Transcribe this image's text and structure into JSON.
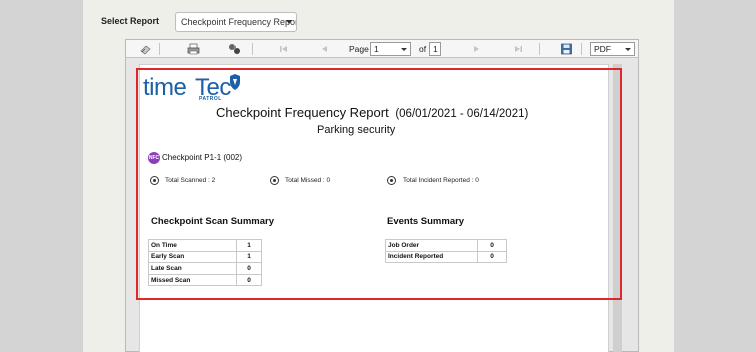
{
  "header": {
    "select_label": "Select Report",
    "report_selected": "Checkpoint Frequency Report"
  },
  "toolbar": {
    "page_label": "Page",
    "page_value": "1",
    "of_label": "of",
    "total_pages": "1",
    "export_format": "PDF"
  },
  "report": {
    "logo_time": "time",
    "logo_tec": "Tec",
    "logo_patrol": "PATROL",
    "title": "Checkpoint Frequency Report",
    "date_range": "(06/01/2021 - 06/14/2021)",
    "subtitle": "Parking security",
    "checkpoint_badge": "NFC",
    "checkpoint_name": "Checkpoint P1-1 (002)",
    "stats": {
      "total_scanned": "Total Scanned      :  2",
      "total_missed": "Total Missed      :  0",
      "total_incident": "Total Incident Reported      :  0"
    },
    "scan_summary": {
      "heading": "Checkpoint Scan Summary",
      "rows": [
        {
          "label": "On Time",
          "value": "1"
        },
        {
          "label": "Early Scan",
          "value": "1"
        },
        {
          "label": "Late Scan",
          "value": "0"
        },
        {
          "label": "Missed Scan",
          "value": "0"
        }
      ]
    },
    "events_summary": {
      "heading": "Events Summary",
      "rows": [
        {
          "label": "Job Order",
          "value": "0"
        },
        {
          "label": "Incident Reported",
          "value": "0"
        }
      ]
    }
  },
  "colors": {
    "highlight": "#e0262d",
    "brand": "#1d5fa8",
    "badge": "#8e3fb8"
  }
}
